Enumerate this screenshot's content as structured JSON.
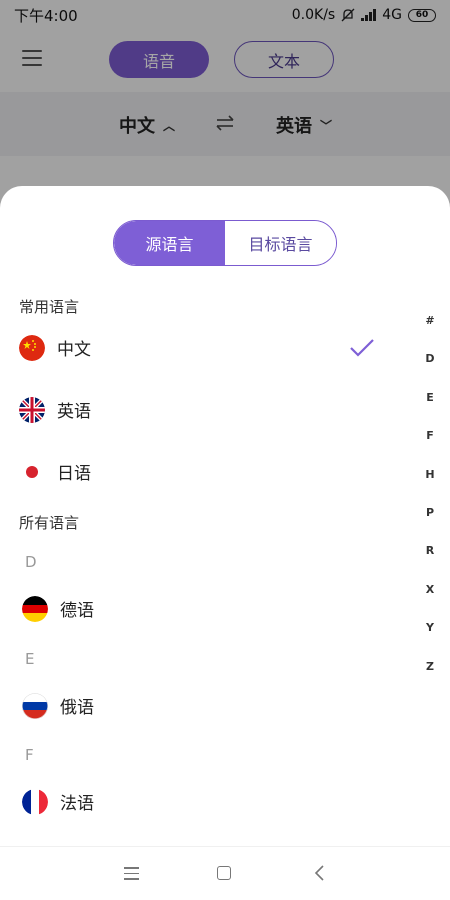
{
  "status_bar": {
    "time": "下午4:00",
    "net_speed": "0.0K/s",
    "network": "4G",
    "battery": "60"
  },
  "top_bar": {
    "voice_label": "语音",
    "text_label": "文本"
  },
  "lang_bar": {
    "source": "中文",
    "target": "英语"
  },
  "sheet": {
    "tabs": [
      {
        "label": "源语言",
        "active": true
      },
      {
        "label": "目标语言",
        "active": false
      }
    ],
    "common_label": "常用语言",
    "common": [
      {
        "name": "中文",
        "flag": "china-flag",
        "selected": true
      },
      {
        "name": "英语",
        "flag": "uk-flag",
        "selected": false
      },
      {
        "name": "日语",
        "flag": "japan-flag",
        "selected": false
      }
    ],
    "all_label": "所有语言",
    "groups": [
      {
        "letter": "D",
        "items": [
          {
            "name": "德语",
            "flag": "germany-flag"
          }
        ]
      },
      {
        "letter": "E",
        "items": [
          {
            "name": "俄语",
            "flag": "russia-flag"
          }
        ]
      },
      {
        "letter": "F",
        "items": [
          {
            "name": "法语",
            "flag": "france-flag"
          }
        ]
      }
    ],
    "index": [
      "#",
      "D",
      "E",
      "F",
      "H",
      "P",
      "R",
      "X",
      "Y",
      "Z"
    ]
  },
  "colors": {
    "accent": "#7e5fd6"
  }
}
